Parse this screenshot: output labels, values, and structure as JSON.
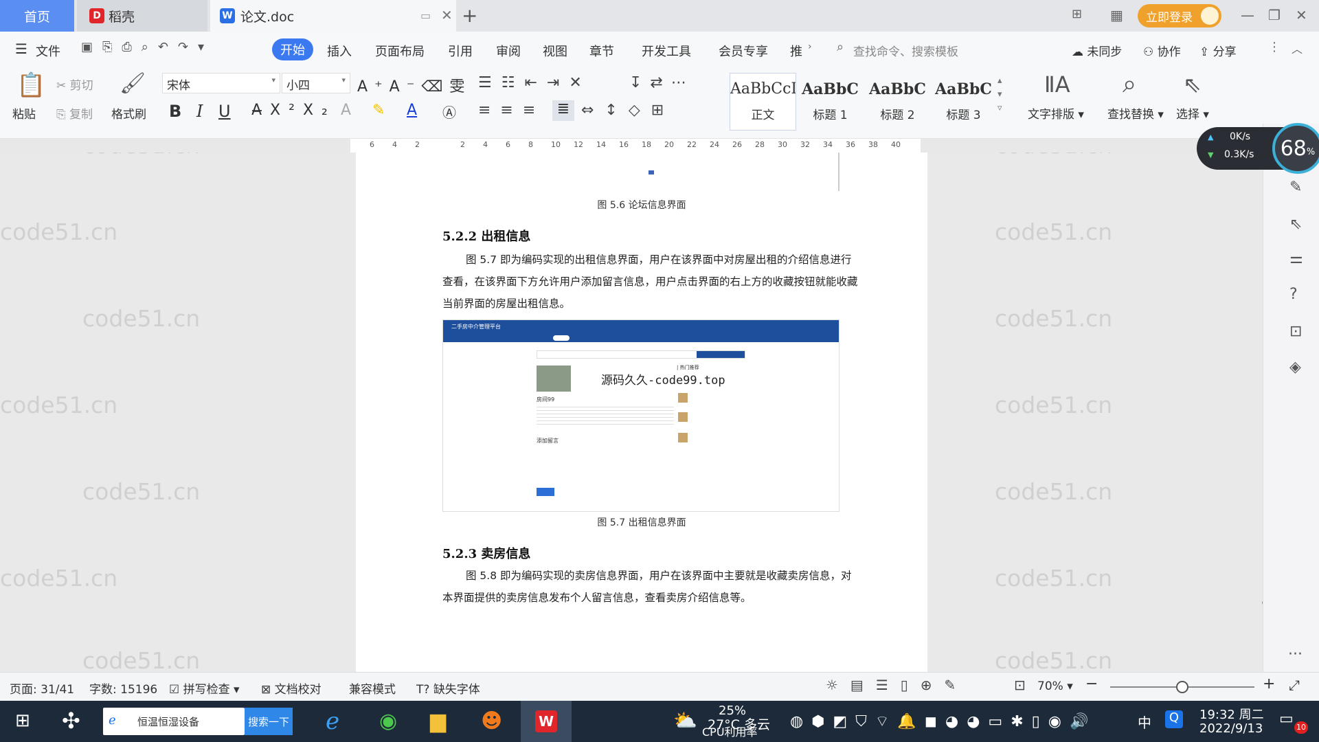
{
  "tabs": {
    "home": "首页",
    "daoke": "稻壳",
    "doc": "论文.doc"
  },
  "title_bar": {
    "login": "立即登录"
  },
  "menu": [
    "文件",
    "开始",
    "插入",
    "页面布局",
    "引用",
    "审阅",
    "视图",
    "章节",
    "开发工具",
    "会员专享",
    "推"
  ],
  "search": {
    "placeholder": "查找命令、搜索模板"
  },
  "top_right": {
    "sync": "未同步",
    "collab": "协作",
    "share": "分享"
  },
  "ribbon": {
    "paste": "粘贴",
    "cut": "剪切",
    "copy": "复制",
    "format_painter": "格式刷",
    "font": "宋体",
    "font_size": "小四",
    "styles": [
      {
        "preview": "AaBbCcI",
        "label": "正文"
      },
      {
        "preview": "AaBbC",
        "label": "标题 1"
      },
      {
        "preview": "AaBbC",
        "label": "标题 2"
      },
      {
        "preview": "AaBbC",
        "label": "标题 3"
      }
    ],
    "text_layout": "文字排版",
    "find_replace": "查找替换",
    "select": "选择"
  },
  "ruler_ticks": [
    "6",
    "4",
    "2",
    "",
    "2",
    "4",
    "6",
    "8",
    "10",
    "12",
    "14",
    "16",
    "18",
    "20",
    "22",
    "24",
    "26",
    "28",
    "30",
    "32",
    "34",
    "36",
    "38",
    "40"
  ],
  "document": {
    "caption_56": "图 5.6  论坛信息界面",
    "heading_522": "5.2.2  出租信息",
    "para_522": "图 5.7 即为编码实现的出租信息界面，用户在该界面中对房屋出租的介绍信息进行查看，在该界面下方允许用户添加留言信息，用户点击界面的右上方的收藏按钮就能收藏当前界面的房屋出租信息。",
    "screenshot": {
      "site_title": "二手房中介管理平台",
      "overlay": "源码久久-code99.top",
      "house_name": "房间99",
      "comment_title": "添加留言",
      "recommend": "| 热门推荐"
    },
    "caption_57": "图 5.7  出租信息界面",
    "heading_523": "5.2.3  卖房信息",
    "para_523": "图 5.8 即为编码实现的卖房信息界面，用户在该界面中主要就是收藏卖房信息，对本界面提供的卖房信息发布个人留言信息，查看卖房介绍信息等。"
  },
  "speed": {
    "up": "0K/s",
    "down": "0.3K/s",
    "percent": "68",
    "unit": "%"
  },
  "status": {
    "page": "页面: 31/41",
    "words": "字数: 15196",
    "spell": "拼写检查",
    "proof": "文档校对",
    "compat": "兼容模式",
    "missing_font": "缺失字体",
    "zoom": "70%"
  },
  "taskbar": {
    "search_text": "恒温恒湿设备",
    "search_btn": "搜索一下",
    "weather_temp": "27°C 多云",
    "cpu_percent": "25%",
    "cpu_label": "CPU利用率",
    "ime": "中",
    "time": "19:32 周二",
    "date": "2022/9/13",
    "notif": "10"
  },
  "watermark": "code51.cn"
}
